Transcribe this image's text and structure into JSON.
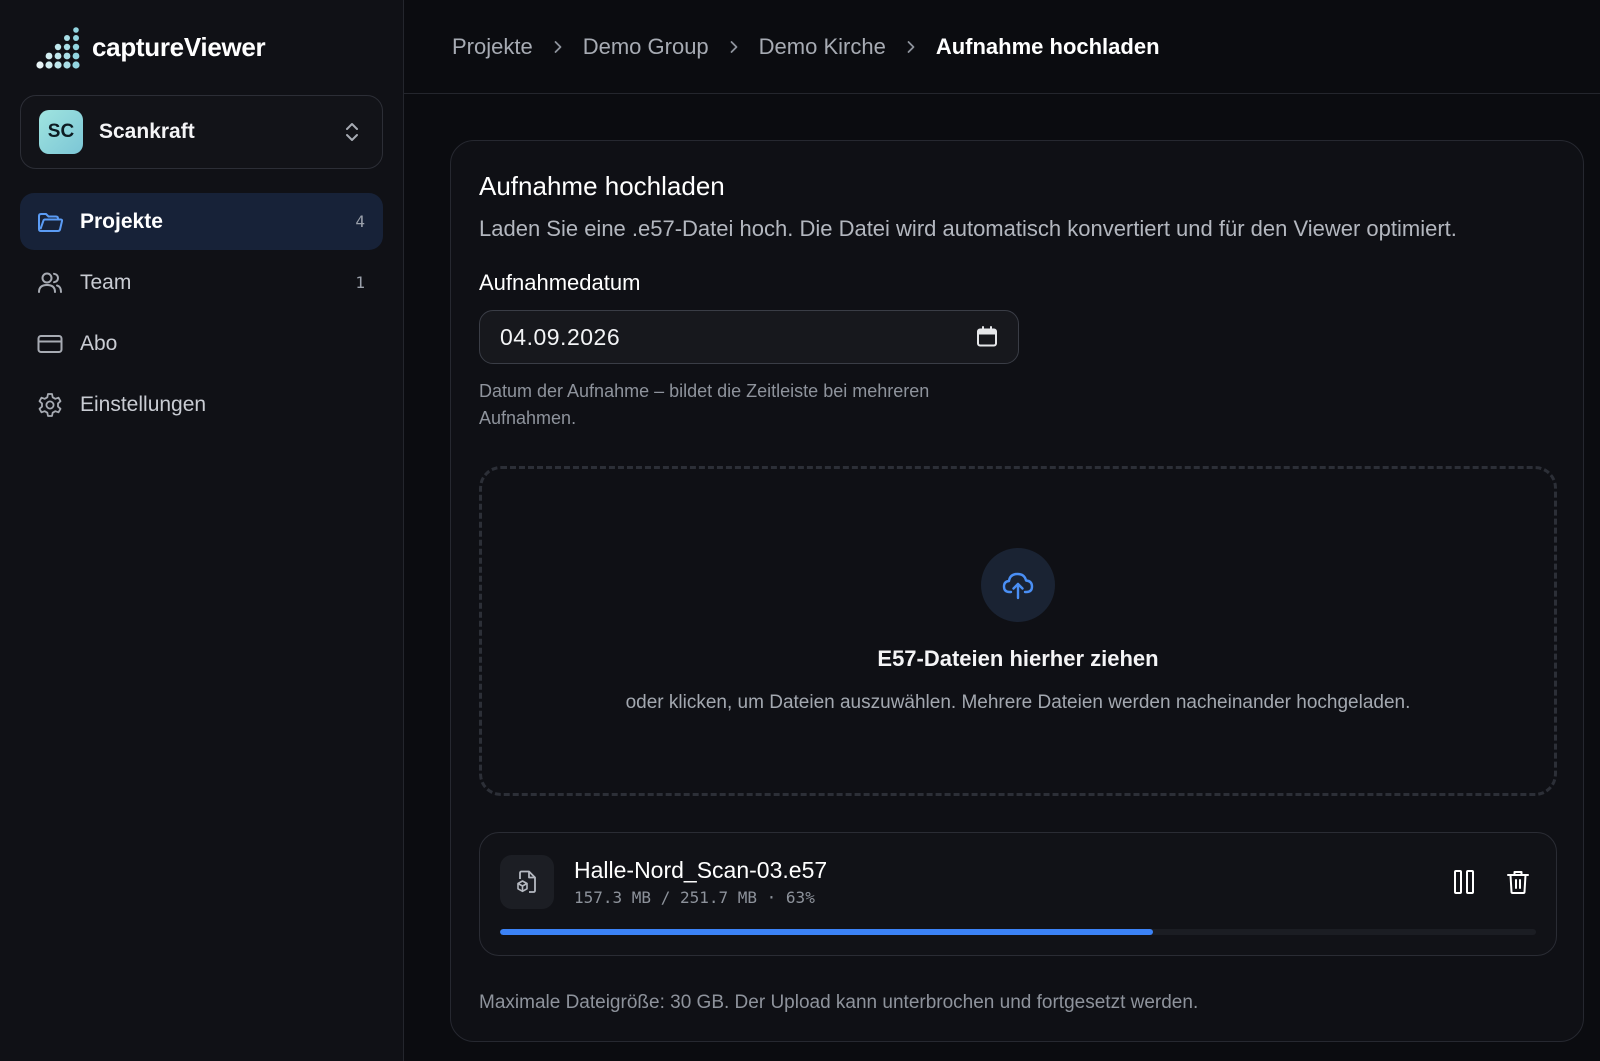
{
  "app": {
    "name": "captureViewer"
  },
  "workspace": {
    "initials": "SC",
    "name": "Scankraft"
  },
  "nav": [
    {
      "icon": "folder-icon",
      "label": "Projekte",
      "count": "4",
      "active": true
    },
    {
      "icon": "users-icon",
      "label": "Team",
      "count": "1",
      "active": false
    },
    {
      "icon": "credit-card-icon",
      "label": "Abo",
      "count": "",
      "active": false
    },
    {
      "icon": "gear-icon",
      "label": "Einstellungen",
      "count": "",
      "active": false
    }
  ],
  "breadcrumb": {
    "items": [
      "Projekte",
      "Demo Group",
      "Demo Kirche"
    ],
    "current": "Aufnahme hochladen"
  },
  "card": {
    "title": "Aufnahme hochladen",
    "description": "Laden Sie eine .e57-Datei hoch. Die Datei wird automatisch konvertiert und für den Viewer optimiert."
  },
  "date_field": {
    "label": "Aufnahmedatum",
    "value": "04.09.2026",
    "hint": "Datum der Aufnahme – bildet die Zeitleiste bei mehreren Aufnahmen."
  },
  "dropzone": {
    "title": "E57-Dateien hierher ziehen",
    "subtitle": "oder klicken, um Dateien auszuwählen. Mehrere Dateien werden nacheinander hochgeladen."
  },
  "upload": {
    "file_name": "Halle-Nord_Scan-03.e57",
    "progress_text": "157.3 MB / 251.7 MB · 63%",
    "progress_fraction": 0.63
  },
  "footer_note": "Maximale Dateigröße: 30 GB. Der Upload kann unterbrochen und fortgesetzt werden.",
  "colors": {
    "accent": "#3b82f6",
    "active_nav_bg": "#172238",
    "background": "#0b0c10"
  }
}
